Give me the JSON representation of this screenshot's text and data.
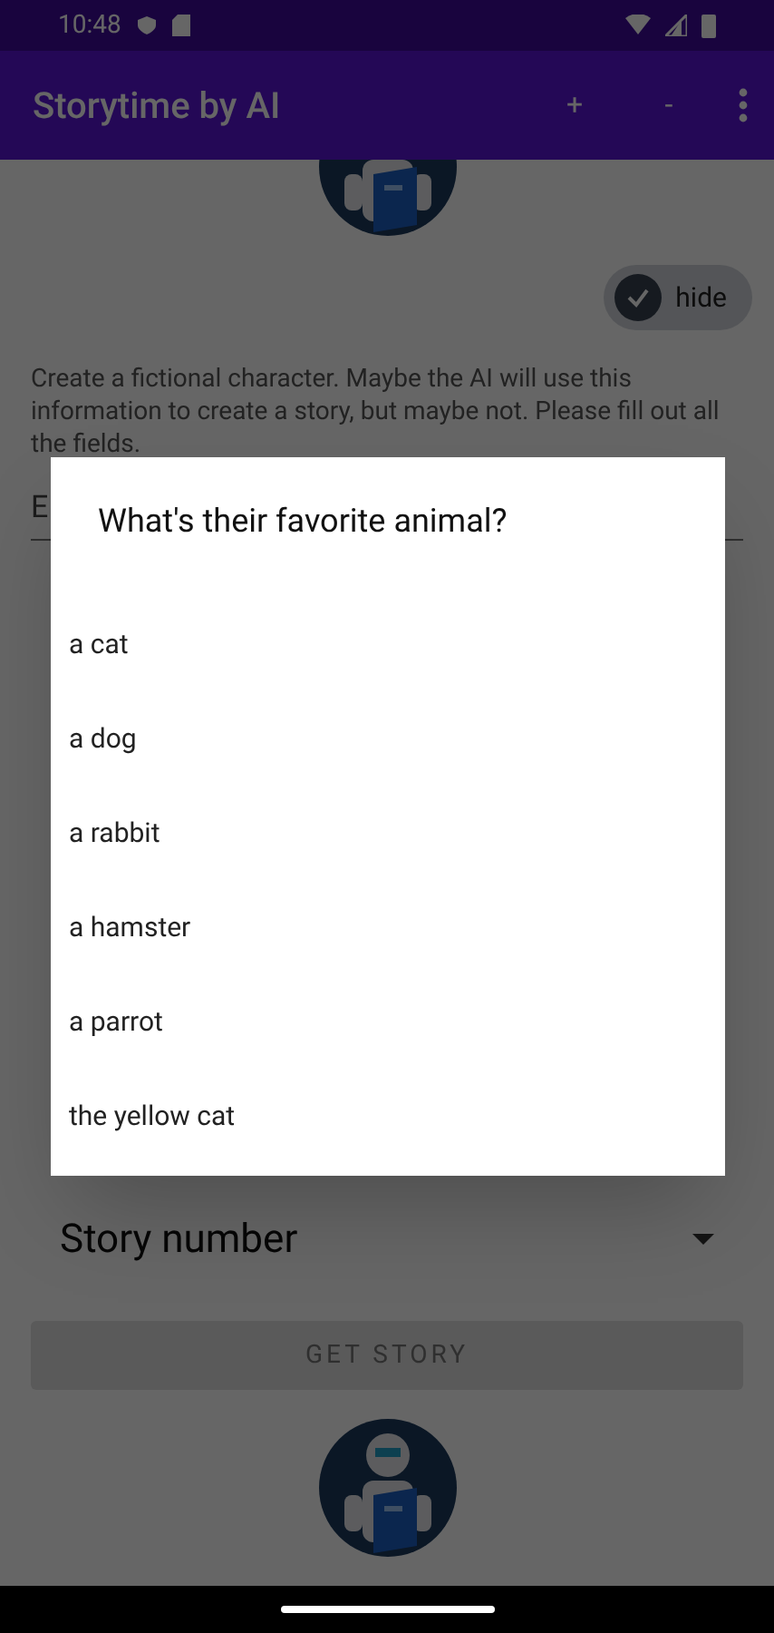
{
  "status_bar": {
    "time": "10:48"
  },
  "app_bar": {
    "title": "Storytime by AI",
    "actions": [
      "+",
      "-"
    ]
  },
  "hide_toggle": {
    "label": "hide",
    "checked": true
  },
  "intro": "Create a fictional character. Maybe the AI will use this information to create a story, but maybe not. Please fill out all the fields.",
  "name_field": {
    "placeholder": "E"
  },
  "story_spinner": {
    "label": "Story number"
  },
  "get_story_button": {
    "label": "GET STORY",
    "disabled": true
  },
  "dialog": {
    "title": "What's their favorite animal?",
    "options": [
      {
        "label": "a cat"
      },
      {
        "label": "a dog"
      },
      {
        "label": "a rabbit"
      },
      {
        "label": "a hamster"
      },
      {
        "label": "a parrot"
      },
      {
        "label": "the yellow cat"
      }
    ]
  }
}
